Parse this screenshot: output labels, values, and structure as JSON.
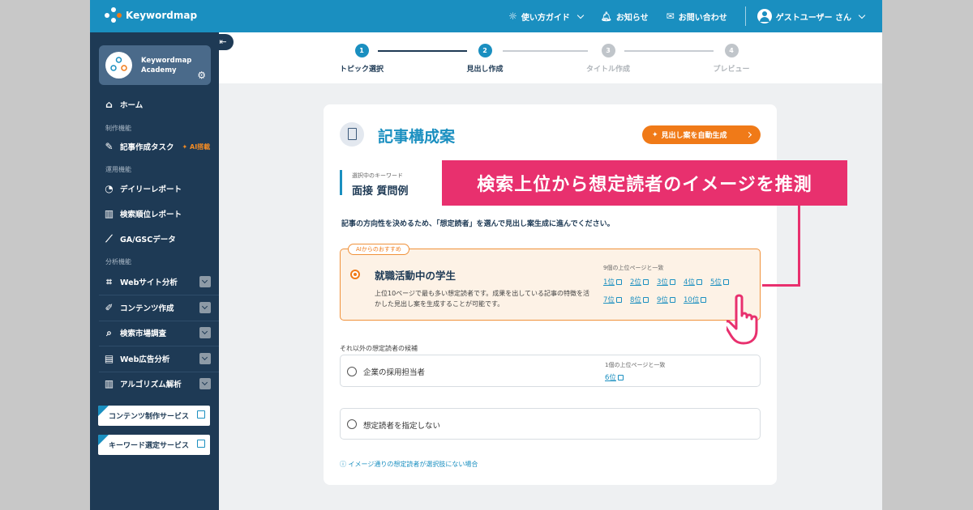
{
  "header": {
    "logo_text": "Keywordmap",
    "guide": "使い方ガイド",
    "notice": "お知らせ",
    "contact": "お問い合わせ",
    "user": "ゲストユーザー さん"
  },
  "sidebar": {
    "academy_name_1": "Keywordmap",
    "academy_name_2": "Academy",
    "home": "ホーム",
    "section_production": "制作機能",
    "article_task": "記事作成タスク",
    "ai_tag": "AI搭載",
    "section_operation": "運用機能",
    "daily_report": "デイリーレポート",
    "rank_report": "検索順位レポート",
    "ga_gsc": "GA/GSCデータ",
    "section_analysis": "分析機能",
    "web_analysis": "Webサイト分析",
    "content_creation": "コンテンツ作成",
    "market_research": "検索市場調査",
    "ad_analysis": "Web広告分析",
    "algorithm": "アルゴリズム解析",
    "ext_content": "コンテンツ制作サービス",
    "ext_keyword": "キーワード選定サービス"
  },
  "steps": [
    {
      "num": "1",
      "label": "トピック選択"
    },
    {
      "num": "2",
      "label": "見出し作成"
    },
    {
      "num": "3",
      "label": "タイトル作成"
    },
    {
      "num": "4",
      "label": "プレビュー"
    }
  ],
  "card": {
    "title": "記事構成案",
    "auto_button": "見出し案を自動生成",
    "keyword_label": "選択中のキーワード",
    "keyword_value": "面接 質問例",
    "instruction": "記事の方向性を決めるため、「想定読者」を選んで見出し案生成に進んでください。",
    "reco_tag": "AIからのおすすめ",
    "reco_title": "就職活動中の学生",
    "reco_desc": "上位10ページで最も多い想定読者です。成果を出している記事の特徴を活かした見出し案を生成することが可能です。",
    "reco_match": "9個の上位ページと一致",
    "reco_ranks": [
      "1位",
      "2位",
      "3位",
      "4位",
      "5位",
      "7位",
      "8位",
      "9位",
      "10位"
    ],
    "others_label": "それ以外の想定読者の候補",
    "opt1_title": "企業の採用担当者",
    "opt1_match": "1個の上位ページと一致",
    "opt1_ranks": [
      "6位"
    ],
    "opt2_title": "想定読者を指定しない",
    "help_link": "イメージ通りの想定読者が選択肢にない場合"
  },
  "overlay": {
    "banner": "検索上位から想定読者のイメージを推測"
  },
  "colors": {
    "header": "#1a8fc0",
    "sidebar": "#1e3a55",
    "accent_orange": "#f07a18",
    "overlay_pink": "#e8306e"
  }
}
